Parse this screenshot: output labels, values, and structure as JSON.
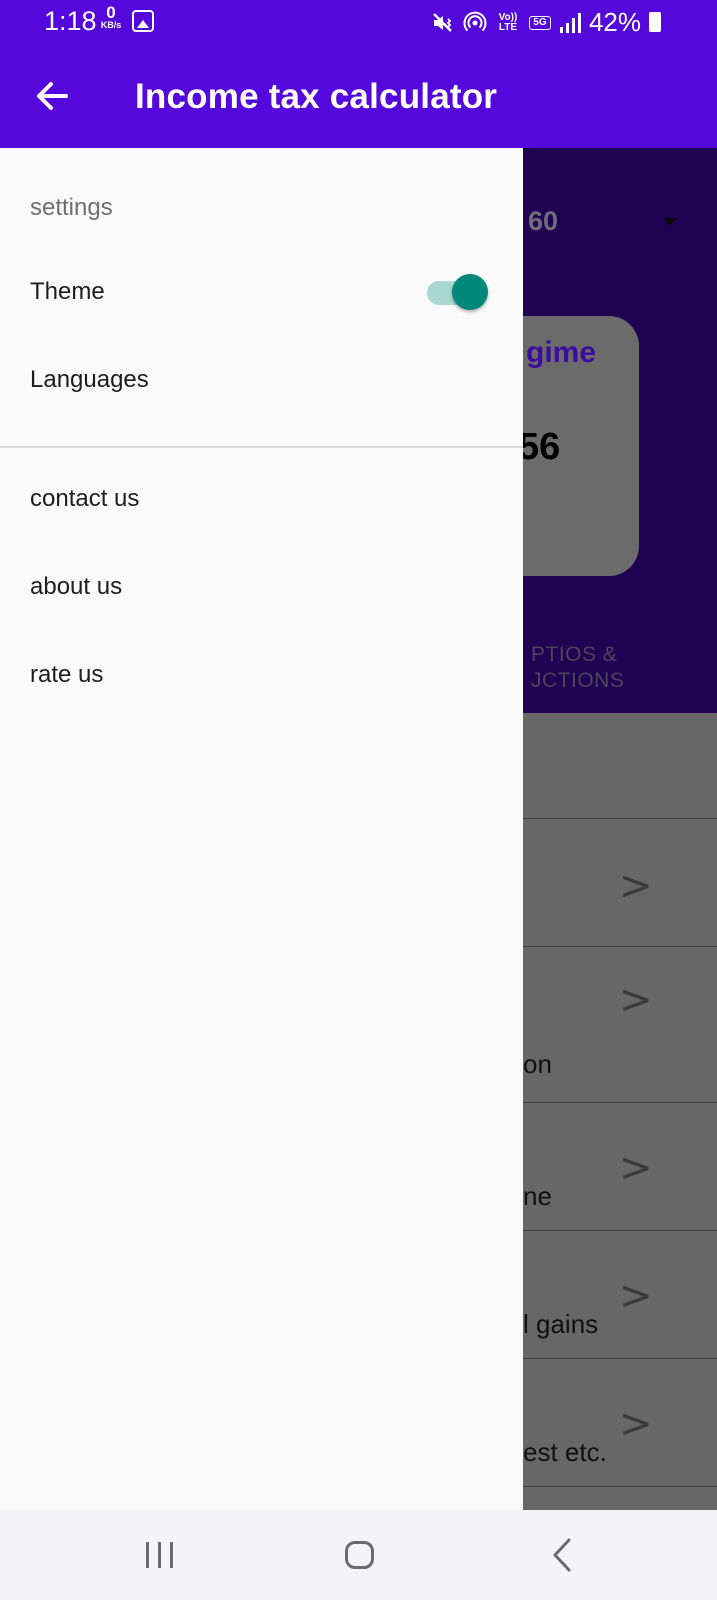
{
  "status_bar": {
    "time": "1:18",
    "net_speed_value": "0",
    "net_speed_unit": "KB/s",
    "volte_label": "Vo)) LTE",
    "network_label": "5G",
    "battery": "42%"
  },
  "app_bar": {
    "title": "Income tax calculator",
    "back_icon": "arrow-left-icon"
  },
  "drawer": {
    "section_header": "settings",
    "settings_items": [
      {
        "label": "Theme",
        "toggle_on": true
      },
      {
        "label": "Languages"
      }
    ],
    "other_items": [
      {
        "label": "contact us"
      },
      {
        "label": "about us"
      },
      {
        "label": "rate us"
      }
    ],
    "toggle_color": "#00897b",
    "toggle_track_color": "#a9d7d2"
  },
  "background_page": {
    "dropdown_value": "60",
    "card_title": "gime",
    "card_value": "56",
    "tab_label_line1": "PTIOS &",
    "tab_label_line2": "JCTIONS",
    "rows": [
      {
        "text": "",
        "chevron": ">"
      },
      {
        "text": "on",
        "chevron": ">"
      },
      {
        "text": "ne",
        "chevron": ">"
      },
      {
        "text": "l gains",
        "chevron": ">"
      },
      {
        "text": "est etc.",
        "chevron": ">"
      }
    ]
  },
  "nav_bar": {
    "recent_icon": "recent-apps-icon",
    "home_icon": "home-icon",
    "back_icon": "back-chevron-icon"
  },
  "colors": {
    "primary": "#5508dc",
    "hero_dim": "#210252",
    "list_dim": "#666766"
  }
}
